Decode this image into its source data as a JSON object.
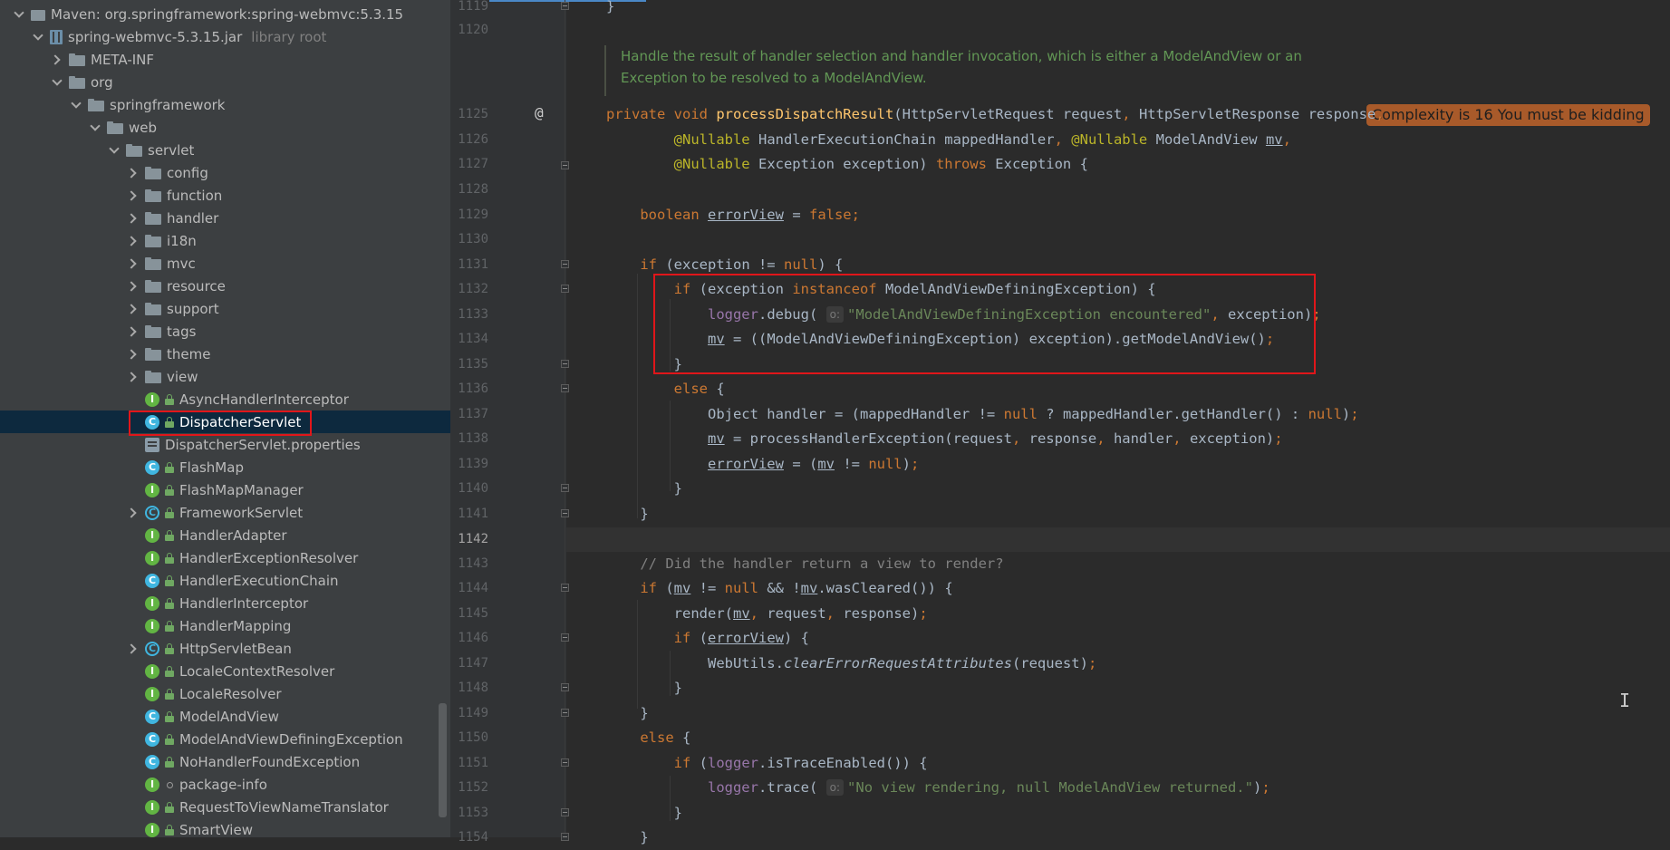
{
  "project_tree": {
    "items": [
      {
        "label": "Maven: org.springframework:spring-webmvc:5.3.15",
        "icon": "maven-library-icon",
        "kind": "maven",
        "arrow": "open",
        "indent": 0
      },
      {
        "label": "spring-webmvc-5.3.15.jar",
        "suffix": "library root",
        "icon": "jar-icon",
        "kind": "jar",
        "arrow": "open",
        "indent": 1
      },
      {
        "label": "META-INF",
        "icon": "folder-icon",
        "kind": "folder",
        "arrow": "closed",
        "indent": 2
      },
      {
        "label": "org",
        "icon": "folder-icon",
        "kind": "folder",
        "arrow": "open",
        "indent": 2
      },
      {
        "label": "springframework",
        "icon": "folder-icon",
        "kind": "folder",
        "arrow": "open",
        "indent": 3
      },
      {
        "label": "web",
        "icon": "folder-icon",
        "kind": "folder",
        "arrow": "open",
        "indent": 4
      },
      {
        "label": "servlet",
        "icon": "folder-icon",
        "kind": "folder",
        "arrow": "open",
        "indent": 5
      },
      {
        "label": "config",
        "icon": "folder-icon",
        "kind": "folder",
        "arrow": "closed",
        "indent": 6
      },
      {
        "label": "function",
        "icon": "folder-icon",
        "kind": "folder",
        "arrow": "closed",
        "indent": 6
      },
      {
        "label": "handler",
        "icon": "folder-icon",
        "kind": "folder",
        "arrow": "closed",
        "indent": 6
      },
      {
        "label": "i18n",
        "icon": "folder-icon",
        "kind": "folder",
        "arrow": "closed",
        "indent": 6
      },
      {
        "label": "mvc",
        "icon": "folder-icon",
        "kind": "folder",
        "arrow": "closed",
        "indent": 6
      },
      {
        "label": "resource",
        "icon": "folder-icon",
        "kind": "folder",
        "arrow": "closed",
        "indent": 6
      },
      {
        "label": "support",
        "icon": "folder-icon",
        "kind": "folder",
        "arrow": "closed",
        "indent": 6
      },
      {
        "label": "tags",
        "icon": "folder-icon",
        "kind": "folder",
        "arrow": "closed",
        "indent": 6
      },
      {
        "label": "theme",
        "icon": "folder-icon",
        "kind": "folder",
        "arrow": "closed",
        "indent": 6
      },
      {
        "label": "view",
        "icon": "folder-icon",
        "kind": "folder",
        "arrow": "closed",
        "indent": 6
      },
      {
        "label": "AsyncHandlerInterceptor",
        "icon": "interface-icon",
        "kind": "interface",
        "arrow": "none",
        "indent": 6
      },
      {
        "label": "DispatcherServlet",
        "icon": "class-icon",
        "kind": "class",
        "arrow": "none",
        "indent": 6,
        "selected": true
      },
      {
        "label": "DispatcherServlet.properties",
        "icon": "properties-file-icon",
        "kind": "props",
        "arrow": "none",
        "indent": 6
      },
      {
        "label": "FlashMap",
        "icon": "class-icon",
        "kind": "class",
        "arrow": "none",
        "indent": 6
      },
      {
        "label": "FlashMapManager",
        "icon": "interface-icon",
        "kind": "interface",
        "arrow": "none",
        "indent": 6
      },
      {
        "label": "FrameworkServlet",
        "icon": "abstract-class-icon",
        "kind": "abstract",
        "arrow": "closed",
        "indent": 6
      },
      {
        "label": "HandlerAdapter",
        "icon": "interface-icon",
        "kind": "interface",
        "arrow": "none",
        "indent": 6
      },
      {
        "label": "HandlerExceptionResolver",
        "icon": "interface-icon",
        "kind": "interface",
        "arrow": "none",
        "indent": 6
      },
      {
        "label": "HandlerExecutionChain",
        "icon": "class-icon",
        "kind": "class",
        "arrow": "none",
        "indent": 6
      },
      {
        "label": "HandlerInterceptor",
        "icon": "interface-icon",
        "kind": "interface",
        "arrow": "none",
        "indent": 6
      },
      {
        "label": "HandlerMapping",
        "icon": "interface-icon",
        "kind": "interface",
        "arrow": "none",
        "indent": 6
      },
      {
        "label": "HttpServletBean",
        "icon": "abstract-class-icon",
        "kind": "abstract",
        "arrow": "closed",
        "indent": 6
      },
      {
        "label": "LocaleContextResolver",
        "icon": "interface-icon",
        "kind": "interface",
        "arrow": "none",
        "indent": 6
      },
      {
        "label": "LocaleResolver",
        "icon": "interface-icon",
        "kind": "interface",
        "arrow": "none",
        "indent": 6
      },
      {
        "label": "ModelAndView",
        "icon": "class-icon",
        "kind": "class",
        "arrow": "none",
        "indent": 6
      },
      {
        "label": "ModelAndViewDefiningException",
        "icon": "exception-class-icon",
        "kind": "exception",
        "arrow": "none",
        "indent": 6
      },
      {
        "label": "NoHandlerFoundException",
        "icon": "exception-class-icon",
        "kind": "exception",
        "arrow": "none",
        "indent": 6
      },
      {
        "label": "package-info",
        "icon": "interface-icon",
        "kind": "interface",
        "arrow": "none",
        "indent": 6,
        "badge": "dot"
      },
      {
        "label": "RequestToViewNameTranslator",
        "icon": "interface-icon",
        "kind": "interface",
        "arrow": "none",
        "indent": 6
      },
      {
        "label": "SmartView",
        "icon": "interface-icon",
        "kind": "interface",
        "arrow": "none",
        "indent": 6
      }
    ]
  },
  "editor": {
    "doc_comment": {
      "line1": "Handle the result of handler selection and handler invocation, which is either a ModelAndView or an",
      "line2": "Exception to be resolved to a ModelAndView."
    },
    "complexity_badge": "Complexity is 16 You must be kidding",
    "gutter_marker": "@",
    "cursor_glyph": "I",
    "line_numbers": [
      "1119",
      "1120",
      "1125",
      "1126",
      "1127",
      "1128",
      "1129",
      "1130",
      "1131",
      "1132",
      "1133",
      "1134",
      "1135",
      "1136",
      "1137",
      "1138",
      "1139",
      "1140",
      "1141",
      "1142",
      "1143",
      "1144",
      "1145",
      "1146",
      "1147",
      "1148",
      "1149",
      "1150",
      "1151",
      "1152",
      "1153",
      "1154"
    ],
    "current_line": "1142",
    "hint_label": "o:",
    "strings": {
      "s1133": "\"ModelAndViewDefiningException encountered\"",
      "s1152": "\"No view rendering, null ModelAndView returned.\""
    },
    "comment_1143": "// Did the handler return a view to render?"
  },
  "colors": {
    "keyword": "#cc7832",
    "method": "#ffc66d",
    "annotation": "#bbb529",
    "string": "#6a8759",
    "comment": "#808080",
    "field": "#9876aa",
    "highlight_box": "#e0161a",
    "complexity_badge": "#a85a2a"
  }
}
